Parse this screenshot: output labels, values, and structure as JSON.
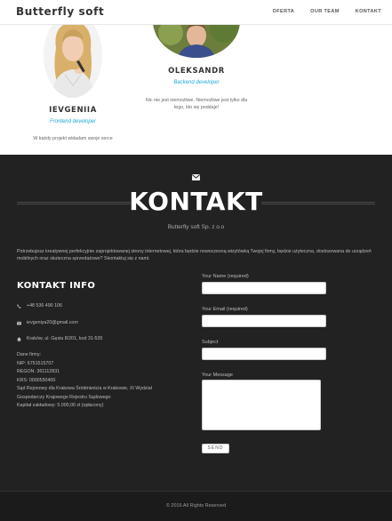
{
  "header": {
    "brand": "Butterfly soft",
    "nav": [
      "OFERTA",
      "OUR TEAM",
      "KONTAKT"
    ]
  },
  "team": {
    "members": [
      {
        "name": "IEVGENIIA",
        "role": "Frontend developer",
        "quote": "W każdy projekt wkładam swoje serce",
        "photo_icon": "woman-portrait"
      },
      {
        "name": "OLEKSANDR",
        "role": "Backend developer",
        "quote": "Nic nie jest niemożliwe. Niemożliwe jest tylko dla tego, kto się poddaje!",
        "photo_icon": "man-portrait"
      }
    ]
  },
  "contact": {
    "icon": "envelope-icon",
    "title": "KONTAKT",
    "subtitle": "Butterfly soft Sp. z o.o",
    "intro": "Potrzebujesz kreatywnej perfekcyjnie zaprojektowanej strony internetowej, która będzie nowoczesną wizytówką Twojej firmy, będzie użyteczna, dostosowana do urządzeń mobilnych oraz skuteczna sprzedażowo? Skontaktuj się z nami.",
    "info_title": "KONTAKT INFO",
    "phone": "+48 536 490 106",
    "email": "ievgeniya20@gmail.com",
    "address": "Kraków, ul. Gęsia 8/201, kod 31-535",
    "company": {
      "heading": "Dane firmy:",
      "nip": "NIP: 6751515707",
      "regon": "REGON: 361112831",
      "krs": "KRS: 0000550400",
      "court_line1": "Sąd Rejonowy dla Krakowa Śródmieścia w Krakowie, XI Wydział",
      "court_line2": "Gospodarczy Krajowego Rejestru Sądowego",
      "capital": "Kapitał zakładowy: 5.000,00 zł (opłacony)"
    },
    "form": {
      "name_label": "Your Name (required)",
      "email_label": "Your Email (required)",
      "subject_label": "Subject",
      "message_label": "Your Message",
      "name_value": "",
      "email_value": "",
      "subject_value": "",
      "message_value": "",
      "send_label": "SEND"
    }
  },
  "footer": {
    "copyright": "© 2016 All Rights Reserved"
  },
  "colors": {
    "accent": "#1fa8d6",
    "dark_bg": "#222222",
    "footer_bg": "#1b1b1b"
  }
}
